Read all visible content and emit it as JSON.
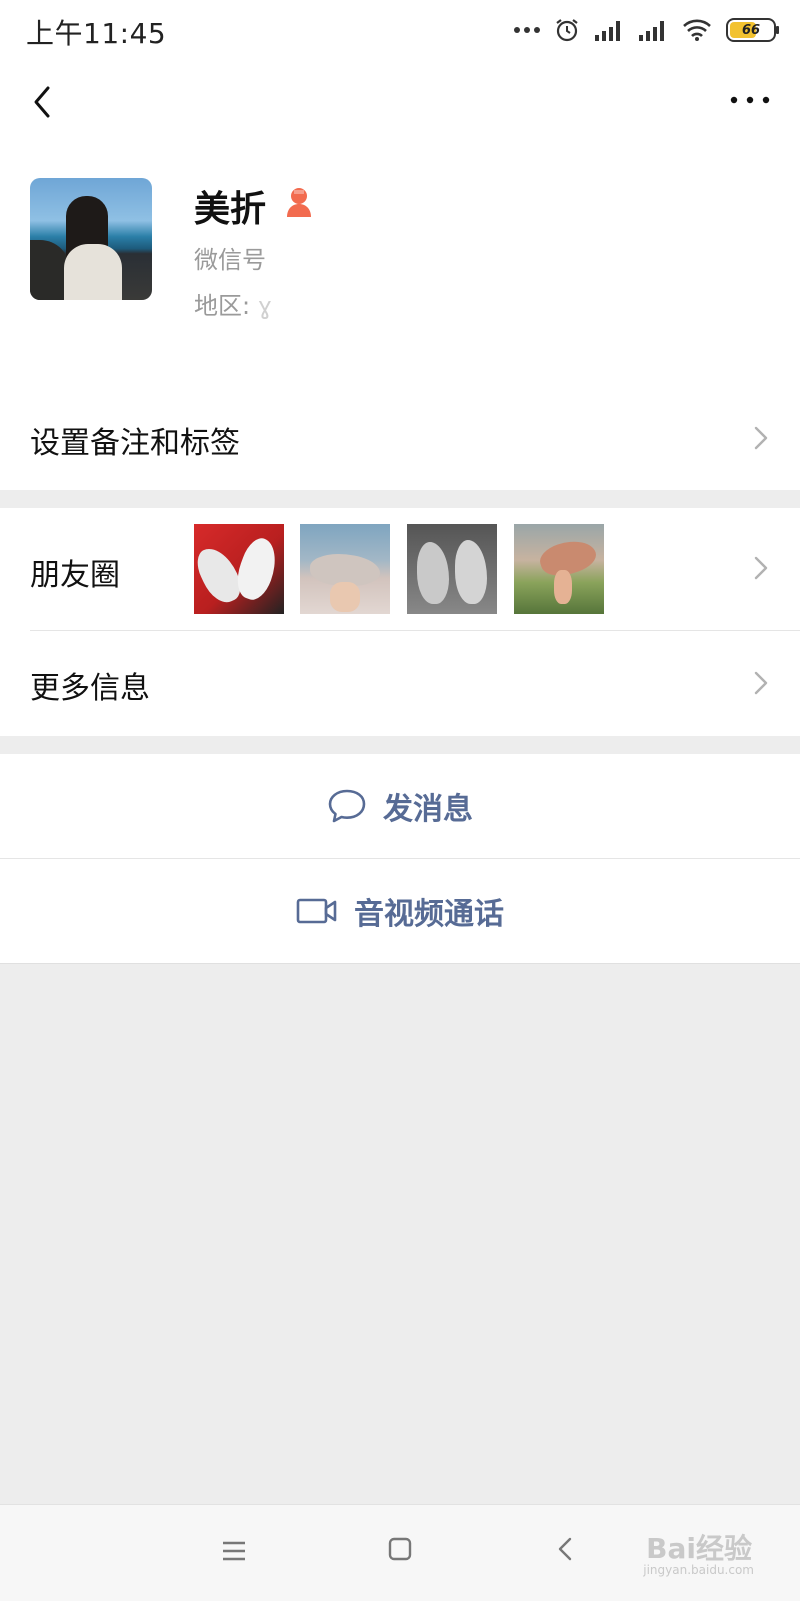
{
  "status_bar": {
    "time": "上午11:45",
    "battery": "66",
    "battery_color": "#f2c230"
  },
  "nav": {
    "back_icon": "chevron-left-icon",
    "more_icon": "more-dots-icon"
  },
  "profile": {
    "nickname": "美折",
    "gender_icon": "female-user-icon",
    "gender_color": "#f26b4f",
    "wechat_id_label": "微信号",
    "region_label": "地区: ",
    "region_value": "ɣ"
  },
  "rows": {
    "remark_tags": "设置备注和标签",
    "moments": "朋友圈",
    "more_info": "更多信息"
  },
  "actions": {
    "send_message": "发消息",
    "video_call": "音视频通话",
    "accent_color": "#576b95"
  },
  "watermark": {
    "brand": "Bai经验",
    "url": "jingyan.baidu.com"
  }
}
